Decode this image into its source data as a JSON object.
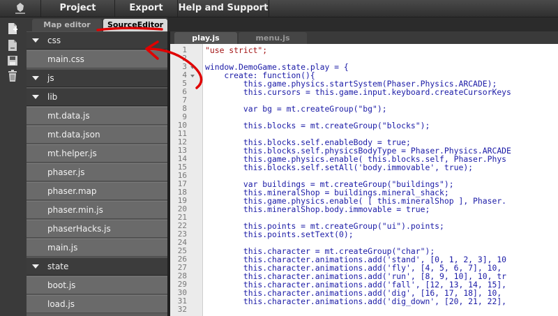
{
  "menu": {
    "project": "Project",
    "export": "Export",
    "help": "Help and Support"
  },
  "panel_tabs": {
    "map_editor": "Map editor",
    "source_editor": "SourceEditor"
  },
  "tree": {
    "items": [
      {
        "type": "folder",
        "label": "css"
      },
      {
        "type": "file",
        "label": "main.css"
      },
      {
        "type": "folder",
        "label": "js"
      },
      {
        "type": "folder",
        "label": "lib"
      },
      {
        "type": "file",
        "label": "mt.data.js"
      },
      {
        "type": "file",
        "label": "mt.data.json"
      },
      {
        "type": "file",
        "label": "mt.helper.js"
      },
      {
        "type": "file",
        "label": "phaser.js"
      },
      {
        "type": "file",
        "label": "phaser.map"
      },
      {
        "type": "file",
        "label": "phaser.min.js"
      },
      {
        "type": "file",
        "label": "phaserHacks.js"
      },
      {
        "type": "file",
        "label": "main.js"
      },
      {
        "type": "folder",
        "label": "state"
      },
      {
        "type": "file",
        "label": "boot.js"
      },
      {
        "type": "file",
        "label": "load.js"
      }
    ]
  },
  "editor": {
    "tabs": [
      "play.js",
      "menu.js"
    ],
    "line_numbers": [
      "1",
      "2",
      "3",
      "4",
      "5",
      "6",
      "7",
      "8",
      "9",
      "10",
      "11",
      "12",
      "13",
      "14",
      "15",
      "16",
      "17",
      "18",
      "19",
      "20",
      "21",
      "22",
      "23",
      "24",
      "25",
      "26",
      "27",
      "28",
      "29",
      "30",
      "31",
      "32"
    ],
    "lines": [
      {
        "t": "\"use strict\";",
        "c": "str"
      },
      {
        "t": "",
        "c": "plain"
      },
      {
        "t": "window.DemoGame.state.play = {",
        "c": "plain"
      },
      {
        "t": "    create: function(){",
        "c": "plain"
      },
      {
        "t": "        this.game.physics.startSystem(Phaser.Physics.ARCADE);",
        "c": "plain"
      },
      {
        "t": "        this.cursors = this.game.input.keyboard.createCursorKeys",
        "c": "plain"
      },
      {
        "t": "",
        "c": "plain"
      },
      {
        "t": "        var bg = mt.createGroup(\"bg\");",
        "c": "plain"
      },
      {
        "t": "",
        "c": "plain"
      },
      {
        "t": "        this.blocks = mt.createGroup(\"blocks\");",
        "c": "plain"
      },
      {
        "t": "",
        "c": "plain"
      },
      {
        "t": "        this.blocks.self.enableBody = true;",
        "c": "plain"
      },
      {
        "t": "        this.blocks.self.physicsBodyType = Phaser.Physics.ARCADE",
        "c": "plain"
      },
      {
        "t": "        this.game.physics.enable( this.blocks.self, Phaser.Phys",
        "c": "plain"
      },
      {
        "t": "        this.blocks.self.setAll('body.immovable', true);",
        "c": "plain"
      },
      {
        "t": "",
        "c": "plain"
      },
      {
        "t": "        var buildings = mt.createGroup(\"buildings\");",
        "c": "plain"
      },
      {
        "t": "        this.mineralShop = buildings.mineral_shack;",
        "c": "plain"
      },
      {
        "t": "        this.game.physics.enable( [ this.mineralShop ], Phaser.",
        "c": "plain"
      },
      {
        "t": "        this.mineralShop.body.immovable = true;",
        "c": "plain"
      },
      {
        "t": "",
        "c": "plain"
      },
      {
        "t": "        this.points = mt.createGroup(\"ui\").points;",
        "c": "plain"
      },
      {
        "t": "        this.points.setText(0);",
        "c": "plain"
      },
      {
        "t": "",
        "c": "plain"
      },
      {
        "t": "        this.character = mt.createGroup(\"char\");",
        "c": "plain"
      },
      {
        "t": "        this.character.animations.add('stand', [0, 1, 2, 3], 10",
        "c": "plain"
      },
      {
        "t": "        this.character.animations.add('fly', [4, 5, 6, 7], 10,",
        "c": "plain"
      },
      {
        "t": "        this.character.animations.add('run', [8, 9, 10], 10, tr",
        "c": "plain"
      },
      {
        "t": "        this.character.animations.add('fall', [12, 13, 14, 15],",
        "c": "plain"
      },
      {
        "t": "        this.character.animations.add('dig', [16, 17, 18], 10,",
        "c": "plain"
      },
      {
        "t": "        this.character.animations.add('dig_down', [20, 21, 22],",
        "c": "plain"
      },
      {
        "t": "",
        "c": "plain"
      }
    ]
  },
  "colors": {
    "code_text": "#1a1aa6",
    "string": "#a31515",
    "annotation": "#e00000"
  }
}
